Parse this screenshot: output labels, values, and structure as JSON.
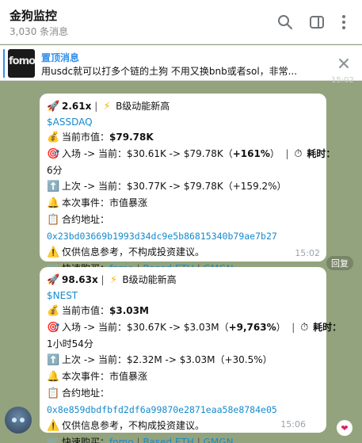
{
  "header": {
    "title": "金狗监控",
    "subtitle": "3,030 条消息",
    "icons": [
      "search-icon",
      "sidebar-icon",
      "more-icon"
    ]
  },
  "pinned": {
    "title": "置顶消息",
    "text": "用usdc就可以打多个链的土狗 不用又换bnb或者sol，非常...",
    "thumb_text": "fomo"
  },
  "messages": [
    {
      "headline_mult": "2.61x",
      "headline_sep": "|",
      "headline_bolt": "⚡",
      "headline_text": "B级动能新高",
      "token": "$ASSDAQ",
      "mcap_label": "当前市值：",
      "mcap_value": "$79.78K",
      "entry_prefix": "入场 -> 当前：$30.61K -> $79.78K（",
      "entry_pct": "+161%",
      "entry_suffix": "）",
      "elapsed_label": "耗时：",
      "elapsed_value": "6分",
      "last_line": "上次 -> 当前：$30.77K -> $79.78K（+159.2%）",
      "event_line": "本次事件：市值暴涨",
      "contract_label": "合约地址：",
      "contract": "0x23bd03669b1993d34dc9e5b86815340b79ae7b27",
      "disclaimer": "仅供信息参考，不构成投资建议。",
      "buy_label": "快速购买：",
      "buy_links": [
        "fomo",
        "Based ETH",
        "GMGN"
      ],
      "time": "15:02"
    },
    {
      "headline_mult": "98.63x",
      "headline_sep": "|",
      "headline_bolt": "⚡",
      "headline_text": "B级动能新高",
      "token": "$NEST",
      "mcap_label": "当前市值：",
      "mcap_value": "$3.03M",
      "entry_prefix": "入场 -> 当前：$30.67K -> $3.03M（",
      "entry_pct": "+9,763%",
      "entry_suffix": "）",
      "elapsed_label": "耗时：",
      "elapsed_value": "1小时54分",
      "last_line": "上次 -> 当前：$2.32M -> $3.03M（+30.5%）",
      "event_line": "本次事件：市值暴涨",
      "contract_label": "合约地址：",
      "contract": "0x8e859dbdfbfd2df6a99870e2871eaa58e8784e05",
      "disclaimer": "仅供信息参考，不构成投资建议。",
      "buy_label": "快速购买：",
      "buy_links": [
        "fomo",
        "Based ETH",
        "GMGN"
      ],
      "time": "15:06"
    }
  ],
  "prev_time_partial": "15:02",
  "reply_label": "回复",
  "reaction": "heart",
  "colors": {
    "accent": "#3390ec",
    "link": "#168acd",
    "background": "#93a37d"
  }
}
